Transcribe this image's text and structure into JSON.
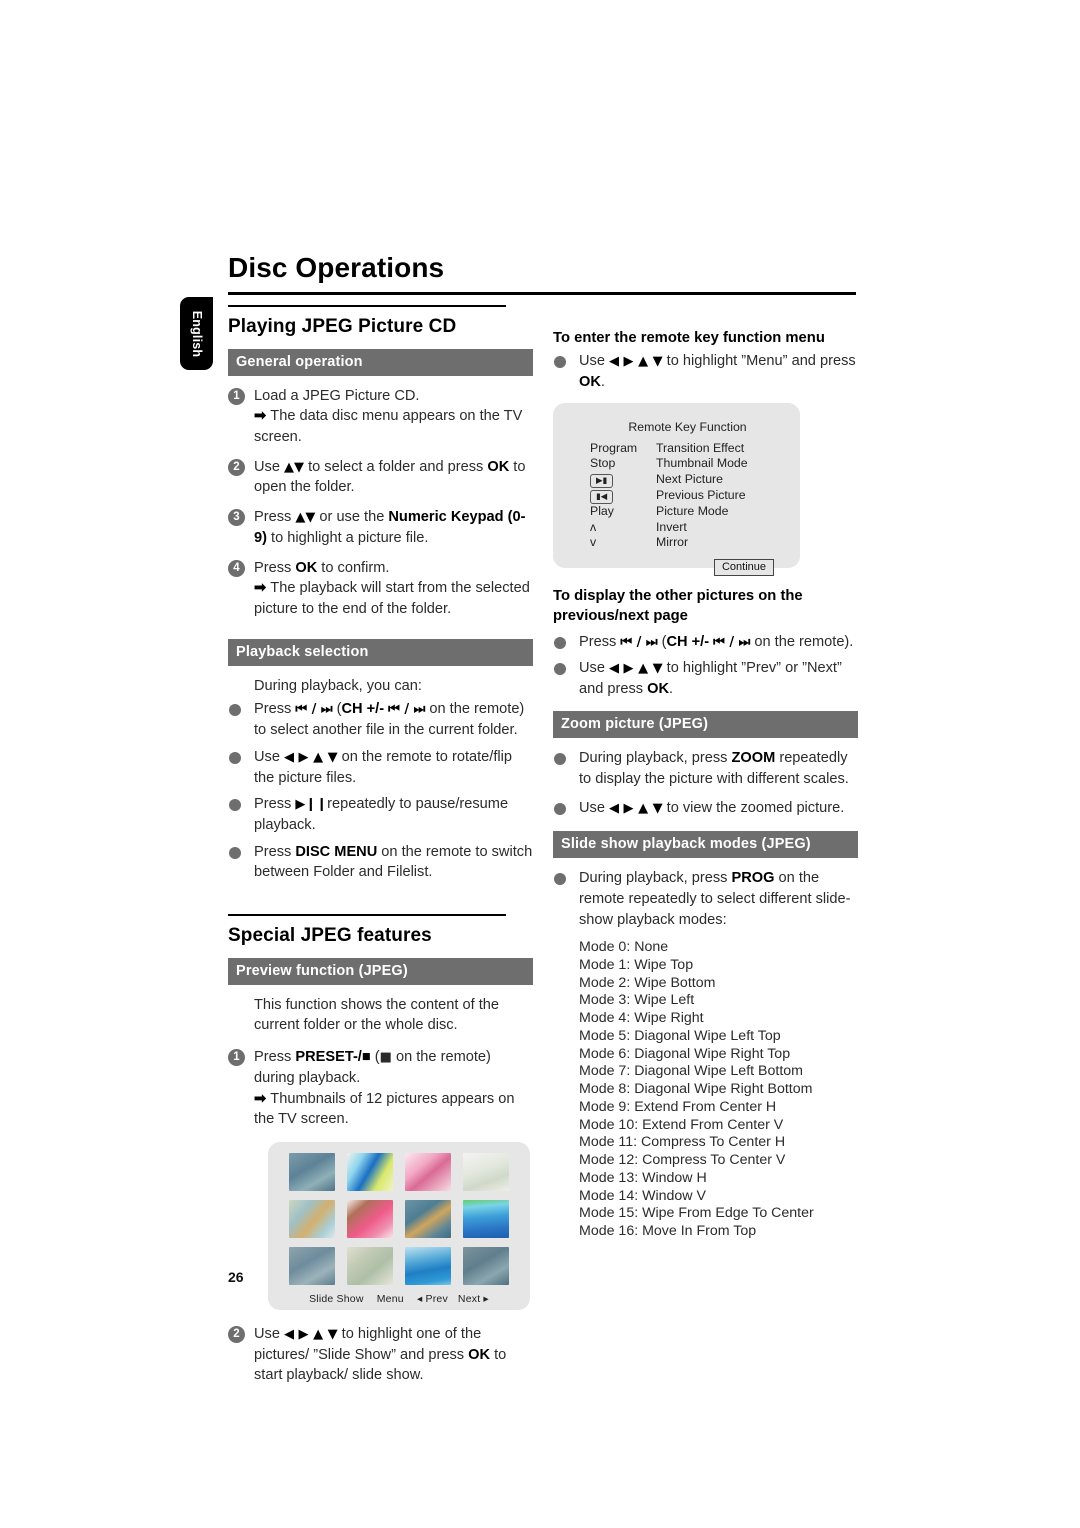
{
  "page_title": "Disc Operations",
  "language_tab": "English",
  "page_number": "26",
  "left": {
    "section1_title": "Playing JPEG Picture CD",
    "bar_general": "General operation",
    "steps": [
      {
        "num": "1",
        "text": "Load a JPEG Picture CD.",
        "arrow": "The data disc menu appears on the TV screen."
      },
      {
        "num": "2",
        "text": "Use ▲▼ to select a folder and press OK to open the folder.",
        "bold": "OK"
      },
      {
        "num": "3",
        "text": "Press ▲▼ or use the Numeric Keypad (0-9) to highlight a picture file.",
        "bold": "Numeric Keypad (0-9)"
      },
      {
        "num": "4",
        "text": "Press OK to confirm.",
        "arrow": "The playback will start from the selected picture to the end of the folder."
      }
    ],
    "bar_playback": "Playback selection",
    "playback_intro": "During playback, you can:",
    "playback_bullets": [
      "Press ⏮ / ⏭ (CH +/- ⏮ / ⏭ on the remote) to select another file in the current folder.",
      "Use ◀ ▶ ▲ ▼ on the remote to rotate/flip the picture files.",
      "Press ▶⏸ repeatedly to pause/resume playback.",
      "Press DISC MENU on the remote to switch between Folder and Filelist."
    ],
    "section2_title": "Special JPEG features",
    "bar_preview": "Preview function (JPEG)",
    "preview_intro": "This function shows the content of the current folder or the whole disc.",
    "preview_step1_num": "1",
    "preview_step1": "Press PRESET-/■ (■ on the remote) during playback.",
    "preview_step1_arrow": "Thumbnails of 12 pictures appears on the TV screen.",
    "preview_step2_num": "2",
    "preview_step2": "Use ◀ ▶ ▲ ▼ to highlight one of the pictures/ “Slide Show” and press OK to start playback/ slide show.",
    "thumb_controls": {
      "slide_show": "Slide Show",
      "menu": "Menu",
      "prev": "◂ Prev",
      "next": "Next ▸"
    }
  },
  "right": {
    "head_remote_menu": "To enter the remote key function menu",
    "remote_menu_bullet": "Use ◀ ▶ ▲ ▼ to highlight “Menu” and press OK.",
    "remote_key_panel": {
      "title": "Remote Key Function",
      "rows": [
        {
          "key": "Program",
          "key_type": "text",
          "value": "Transition Effect"
        },
        {
          "key": "Stop",
          "key_type": "text",
          "value": "Thumbnail Mode"
        },
        {
          "key": "▶▮",
          "key_type": "box",
          "value": "Next Picture"
        },
        {
          "key": "▮◀",
          "key_type": "box",
          "value": "Previous Picture"
        },
        {
          "key": "Play",
          "key_type": "text",
          "value": "Picture Mode"
        },
        {
          "key": "ʌ",
          "key_type": "text",
          "value": "Invert"
        },
        {
          "key": "v",
          "key_type": "text",
          "value": "Mirror"
        }
      ],
      "continue_label": "Continue"
    },
    "head_other_pictures": "To display the other pictures on the previous/next page",
    "other_pictures_bullets": [
      "Press ⏮ / ⏭ (CH +/- ⏮ / ⏭ on the remote).",
      "Use ◀ ▶ ▲ ▼ to highlight “Prev” or “Next” and press OK."
    ],
    "bar_zoom": "Zoom picture (JPEG)",
    "zoom_bullets": [
      "During playback, press ZOOM repeatedly to display the picture with different scales.",
      "Use ◀ ▶ ▲ ▼ to view the zoomed picture."
    ],
    "bar_slideshow": "Slide show playback modes (JPEG)",
    "slideshow_bullet": "During playback, press PROG on the remote repeatedly to select different slide-show playback modes:",
    "modes": [
      "Mode 0: None",
      "Mode 1: Wipe Top",
      "Mode 2: Wipe Bottom",
      "Mode 3: Wipe Left",
      "Mode 4: Wipe Right",
      "Mode 5: Diagonal Wipe Left Top",
      "Mode 6: Diagonal Wipe Right Top",
      "Mode 7: Diagonal Wipe Left Bottom",
      "Mode 8: Diagonal Wipe Right Bottom",
      "Mode 9: Extend From Center H",
      "Mode 10: Extend From Center V",
      "Mode 11: Compress To Center H",
      "Mode 12: Compress To Center V",
      "Mode 13: Window H",
      "Mode 14: Window V",
      "Mode 15: Wipe From Edge To Center",
      "Mode 16: Move In From Top"
    ]
  },
  "colors": {
    "bar_grey": "#6e6e6e",
    "panel_grey": "#e6e6e6",
    "rule_black": "#000000"
  }
}
